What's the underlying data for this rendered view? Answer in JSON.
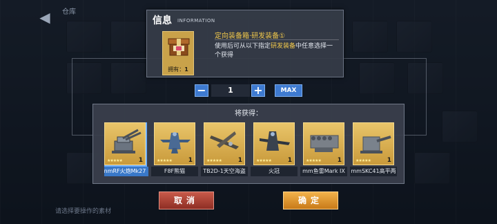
{
  "background": {
    "header_label": "仓库",
    "hint_text": "请选择要操作的素材"
  },
  "info": {
    "title": "信息",
    "subtitle": "INFORMATION",
    "item_name": "定向装备箱·研发装备①",
    "desc_before": "使用后可从以下指定",
    "desc_highlight": "研发装备",
    "desc_after": "中任意选择一个获得",
    "owned_label": "拥有：",
    "owned_count": "1",
    "icon": "gift-box-icon"
  },
  "quantity": {
    "minus_label": "−",
    "value": "1",
    "plus_label": "+",
    "max_label": "MAX"
  },
  "rewards": {
    "title": "将获得：",
    "items": [
      {
        "name": "nmRF火炮Mk27",
        "count": "1",
        "icon": "naval-gun-icon",
        "selected": true
      },
      {
        "name": "F8F熊猫",
        "count": "1",
        "icon": "fighter-plane-icon",
        "selected": false
      },
      {
        "name": "TB2D-1天空海盗",
        "count": "1",
        "icon": "torpedo-bomber-icon",
        "selected": false
      },
      {
        "name": "火冠",
        "count": "1",
        "icon": "fighter-plane-icon",
        "selected": false
      },
      {
        "name": "mm鱼雷Mark IX",
        "count": "1",
        "icon": "torpedo-launcher-icon",
        "selected": false
      },
      {
        "name": "mmSKC41高平两",
        "count": "1",
        "icon": "turret-icon",
        "selected": false
      }
    ]
  },
  "buttons": {
    "cancel_label": "取消",
    "confirm_label": "确定"
  },
  "colors": {
    "accent_blue": "#3e7ad0",
    "gold": "#f2c94c",
    "cancel_red": "#b54535",
    "confirm_orange": "#e89a2e"
  }
}
